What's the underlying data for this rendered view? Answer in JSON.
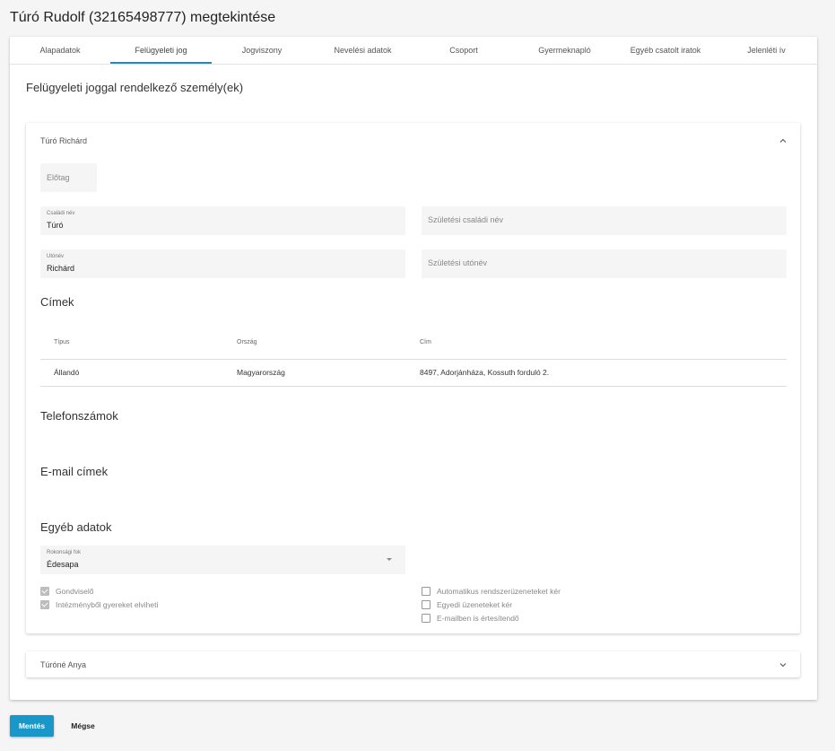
{
  "page": {
    "title": "Túró Rudolf (32165498777) megtekintése"
  },
  "tabs": [
    {
      "label": "Alapadatok"
    },
    {
      "label": "Felügyeleti jog"
    },
    {
      "label": "Jogviszony"
    },
    {
      "label": "Nevelési adatok"
    },
    {
      "label": "Csoport"
    },
    {
      "label": "Gyermeknapló"
    },
    {
      "label": "Egyéb csatolt iratok"
    },
    {
      "label": "Jelenléti ív"
    }
  ],
  "section": {
    "title": "Felügyeleti joggal rendelkező személy(ek)"
  },
  "person1": {
    "name": "Túró Richárd",
    "fields": {
      "prefix": {
        "placeholder": "Előtag"
      },
      "family_name": {
        "label": "Családi név",
        "value": "Túró"
      },
      "birth_family_name": {
        "placeholder": "Születési családi név"
      },
      "given_name": {
        "label": "Utónév",
        "value": "Richárd"
      },
      "birth_given_name": {
        "placeholder": "Születési utónév"
      }
    },
    "addresses": {
      "title": "Címek",
      "headers": {
        "type": "Típus",
        "country": "Ország",
        "address": "Cím"
      },
      "rows": [
        {
          "type": "Állandó",
          "country": "Magyarország",
          "address": "8497, Adorjánháza, Kossuth forduló 2."
        }
      ]
    },
    "phones": {
      "title": "Telefonszámok"
    },
    "emails": {
      "title": "E-mail címek"
    },
    "other": {
      "title": "Egyéb adatok",
      "relation": {
        "label": "Rokonsági fok",
        "value": "Édesapa"
      },
      "checks_left": [
        {
          "label": "Gondviselő",
          "checked": true
        },
        {
          "label": "Intézményből gyereket elviheti",
          "checked": true
        }
      ],
      "checks_right": [
        {
          "label": "Automatikus rendszerüzeneteket kér",
          "checked": false
        },
        {
          "label": "Egyedi üzeneteket kér",
          "checked": false
        },
        {
          "label": "E-mailben is értesítendő",
          "checked": false
        }
      ]
    }
  },
  "person2": {
    "name": "Túróné Anya"
  },
  "actions": {
    "save": "Mentés",
    "cancel": "Mégse"
  },
  "colors": {
    "accent": "#1a97c9",
    "tab_underline": "#1a8dc3"
  }
}
